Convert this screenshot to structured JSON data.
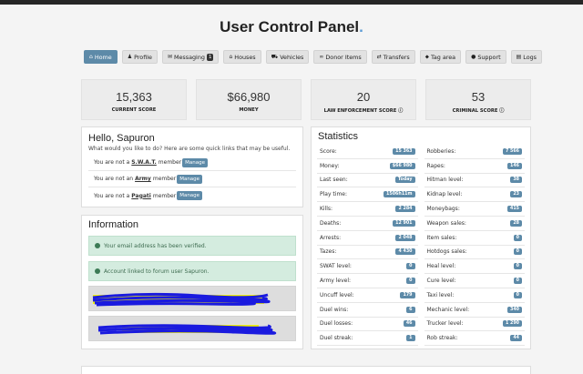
{
  "title": "User Control Panel",
  "title_dot": ".",
  "nav": [
    {
      "label": "Home",
      "icon": "home-icon",
      "glyph": "⌂",
      "active": true
    },
    {
      "label": "Profile",
      "icon": "user-icon",
      "glyph": "♟"
    },
    {
      "label": "Messaging",
      "icon": "envelope-icon",
      "glyph": "✉",
      "badge": "1"
    },
    {
      "label": "Houses",
      "icon": "house-icon",
      "glyph": "⌂"
    },
    {
      "label": "Vehicles",
      "icon": "car-icon",
      "glyph": "⛟"
    },
    {
      "label": "Donor Items",
      "icon": "mask-icon",
      "glyph": "∞"
    },
    {
      "label": "Transfers",
      "icon": "transfer-icon",
      "glyph": "⇄"
    },
    {
      "label": "Tag area",
      "icon": "tag-icon",
      "glyph": "⬥"
    },
    {
      "label": "Support",
      "icon": "chat-icon",
      "glyph": "●"
    },
    {
      "label": "Logs",
      "icon": "file-icon",
      "glyph": "▤"
    }
  ],
  "summary": [
    {
      "value": "15,363",
      "label": "CURRENT SCORE"
    },
    {
      "value": "$66,980",
      "label": "MONEY"
    },
    {
      "value": "20",
      "label": "LAW ENFORCEMENT SCORE ⓘ"
    },
    {
      "value": "53",
      "label": "CRIMINAL SCORE ⓘ"
    }
  ],
  "hello": {
    "title": "Hello, Sapuron",
    "subtitle": "What would you like to do? Here are some quick links that may be useful.",
    "rows": [
      {
        "prefix": "You are not a",
        "org": "S.W.A.T.",
        "suffix": "member",
        "button": "Manage"
      },
      {
        "prefix": "You are not an",
        "org": "Army",
        "suffix": "member",
        "button": "Manage"
      },
      {
        "prefix": "You are not a",
        "org": "Pagati",
        "suffix": "member",
        "button": "Manage"
      }
    ]
  },
  "information": {
    "title": "Information",
    "alerts": [
      "Your email address has been verified.",
      "Account linked to forum user Sapuron."
    ]
  },
  "statistics": {
    "title": "Statistics",
    "left": [
      {
        "label": "Score:",
        "value": "15 363"
      },
      {
        "label": "Money:",
        "value": "$66 980"
      },
      {
        "label": "Last seen:",
        "value": "Today"
      },
      {
        "label": "Play time:",
        "value": "1506h11m"
      },
      {
        "label": "Kills:",
        "value": "2 284"
      },
      {
        "label": "Deaths:",
        "value": "12 901"
      },
      {
        "label": "Arrests:",
        "value": "2 048"
      },
      {
        "label": "Tazes:",
        "value": "4 430"
      },
      {
        "label": "SWAT level:",
        "value": "0"
      },
      {
        "label": "Army level:",
        "value": "0"
      },
      {
        "label": "Uncuff level:",
        "value": "179"
      },
      {
        "label": "Duel wins:",
        "value": "6"
      },
      {
        "label": "Duel losses:",
        "value": "46"
      },
      {
        "label": "Duel streak:",
        "value": "1"
      }
    ],
    "right": [
      {
        "label": "Robberies:",
        "value": "7 566"
      },
      {
        "label": "Rapes:",
        "value": "146"
      },
      {
        "label": "Hitman level:",
        "value": "38"
      },
      {
        "label": "Kidnap level:",
        "value": "23"
      },
      {
        "label": "Moneybags:",
        "value": "415"
      },
      {
        "label": "Weapon sales:",
        "value": "28"
      },
      {
        "label": "Item sales:",
        "value": "0"
      },
      {
        "label": "Hotdogs sales:",
        "value": "0"
      },
      {
        "label": "Heal level:",
        "value": "0"
      },
      {
        "label": "Cure level:",
        "value": "0"
      },
      {
        "label": "Taxi level:",
        "value": "0"
      },
      {
        "label": "Mechanic level:",
        "value": "340"
      },
      {
        "label": "Trucker level:",
        "value": "1 290"
      },
      {
        "label": "Rob streak:",
        "value": "44"
      }
    ]
  },
  "colors": {
    "accent": "#5d8aa8",
    "alert_bg": "#d4ecdf",
    "scribble_blue": "#1a1adf",
    "scribble_yellow": "#f2f20a"
  }
}
